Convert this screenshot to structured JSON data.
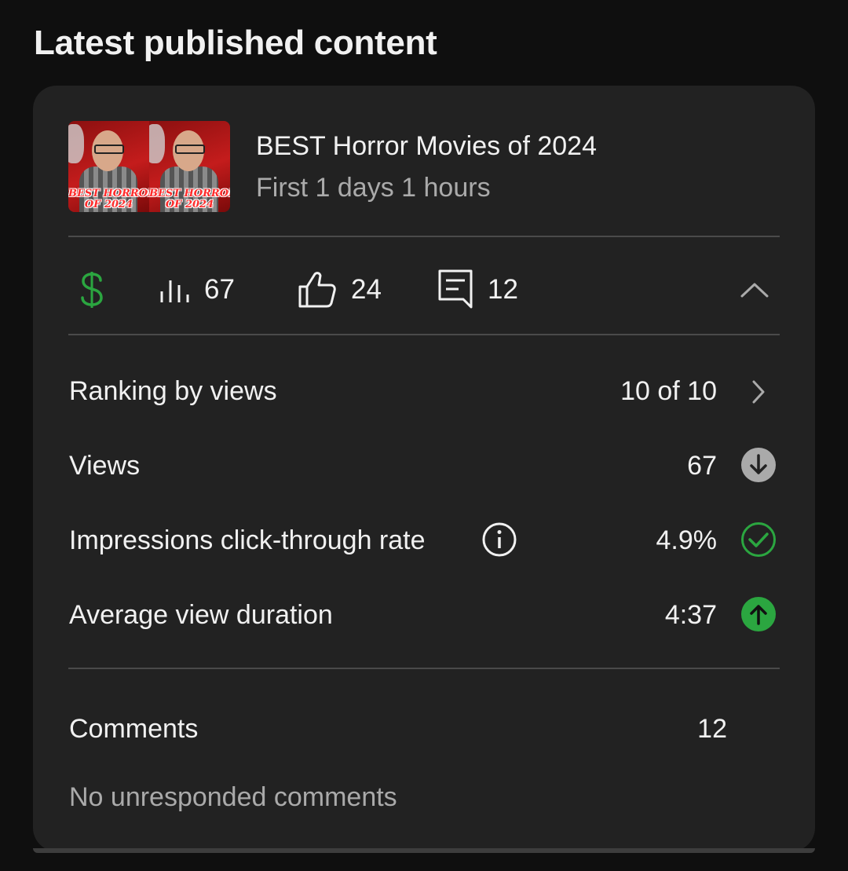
{
  "section": {
    "title": "Latest published content"
  },
  "video": {
    "title": "BEST Horror Movies of 2024",
    "subtitle": "First 1 days 1 hours",
    "thumbnail_text": [
      "BEST HORROR",
      "OF 2024"
    ]
  },
  "stats": {
    "revenue_icon": "dollar-icon",
    "revenue_color": "#2ba640",
    "views": "67",
    "likes": "24",
    "comments": "12"
  },
  "metrics": [
    {
      "label": "Ranking by views",
      "value": "10 of 10",
      "icon": "chevron-right-icon"
    },
    {
      "label": "Views",
      "value": "67",
      "icon": "arrow-down-icon",
      "icon_color": "#aaaaaa"
    },
    {
      "label": "Impressions click-through rate",
      "value": "4.9%",
      "icon": "check-circle-icon",
      "icon_color": "#2ba640"
    },
    {
      "label": "Average view duration",
      "value": "4:37",
      "icon": "arrow-up-icon",
      "icon_color": "#2ba640"
    }
  ],
  "comments_section": {
    "label": "Comments",
    "count": "12",
    "status": "No unresponded comments"
  }
}
